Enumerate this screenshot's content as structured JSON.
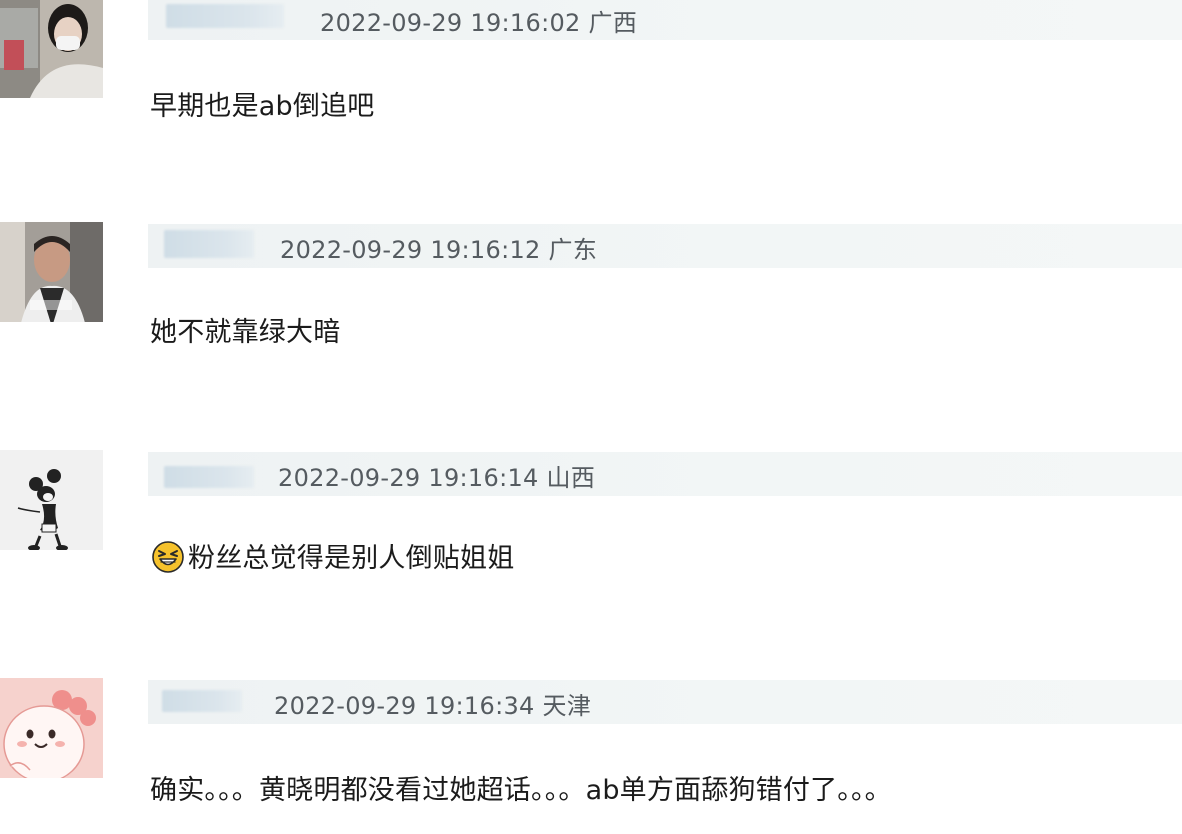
{
  "comments": [
    {
      "timestamp": "2022-09-29 19:16:02 广西",
      "text": "早期也是ab倒追吧",
      "avatar_icon": "woman-with-mask-avatar"
    },
    {
      "timestamp": "2022-09-29 19:16:12 广东",
      "text": "她不就靠绿大暗",
      "avatar_icon": "man-photo-avatar"
    },
    {
      "timestamp": "2022-09-29 19:16:14 山西",
      "text": "粉丝总觉得是别人倒贴姐姐",
      "emoji": "squinting-laugh-emoji",
      "avatar_icon": "cartoon-mouse-avatar"
    },
    {
      "timestamp": "2022-09-29 19:16:34 天津",
      "text": "确实。。。黄晓明都没看过她超话。。。ab单方面舔狗错付了。。。",
      "avatar_icon": "pink-cartoon-avatar"
    }
  ]
}
